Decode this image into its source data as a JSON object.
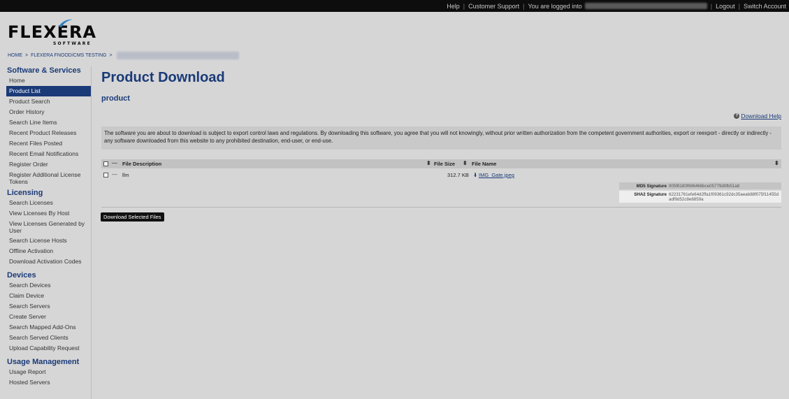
{
  "topbar": {
    "help": "Help",
    "support": "Customer Support",
    "logged_in": "You are logged into",
    "logout": "Logout",
    "switch_account": "Switch Account"
  },
  "logo": {
    "text": "FLEXERA",
    "subtext": "SOFTWARE"
  },
  "breadcrumb": {
    "home": "HOME",
    "account": "FLEXERA FNOOD/CMS TESTING"
  },
  "sidebar": {
    "sections": [
      {
        "title": "Software & Services",
        "items": [
          {
            "label": "Home"
          },
          {
            "label": "Product List",
            "active": true
          },
          {
            "label": "Product Search"
          },
          {
            "label": "Order History"
          },
          {
            "label": "Search Line Items"
          },
          {
            "label": "Recent Product Releases"
          },
          {
            "label": "Recent Files Posted"
          },
          {
            "label": "Recent Email Notifications"
          },
          {
            "label": "Register Order"
          },
          {
            "label": "Register Additional License Tokens"
          }
        ]
      },
      {
        "title": "Licensing",
        "items": [
          {
            "label": "Search Licenses"
          },
          {
            "label": "View Licenses By Host"
          },
          {
            "label": "View Licenses Generated by User"
          },
          {
            "label": "Search License Hosts"
          },
          {
            "label": "Offline Activation"
          },
          {
            "label": "Download Activation Codes"
          }
        ]
      },
      {
        "title": "Devices",
        "items": [
          {
            "label": "Search Devices"
          },
          {
            "label": "Claim Device"
          },
          {
            "label": "Search Servers"
          },
          {
            "label": "Create Server"
          },
          {
            "label": "Search Mapped Add-Ons"
          },
          {
            "label": "Search Served Clients"
          },
          {
            "label": "Upload Capability Request"
          }
        ]
      },
      {
        "title": "Usage Management",
        "items": [
          {
            "label": "Usage Report"
          },
          {
            "label": "Hosted Servers"
          }
        ]
      }
    ]
  },
  "main": {
    "title": "Product Download",
    "subtitle": "product",
    "help_link": "Download Help",
    "notice": "The software you are about to download is subject to export control laws and regulations. By downloading this software, you agree that you will not knowingly, without prior written authorization from the competent government authorities, export or reexport - directly or indirectly - any software downloaded from this website to any prohibited destination, end-user, or end-use.",
    "table": {
      "columns": {
        "description": "File Description",
        "size": "File Size",
        "name": "File Name"
      },
      "rows": [
        {
          "description": "llm",
          "size": "312.7 KB",
          "name": "IMG_Gate.jpeg",
          "md5_label": "MD5 Signature",
          "md5": "905f8180f696466bce05779d0fb51a8",
          "sha2_label": "SHA2 Signature",
          "sha2": "62231761efe64d2ffa1f09361c92dc35aeab88f075f11455dadf9d52c8e8859a"
        }
      ]
    },
    "download_button": "Download Selected Files"
  }
}
